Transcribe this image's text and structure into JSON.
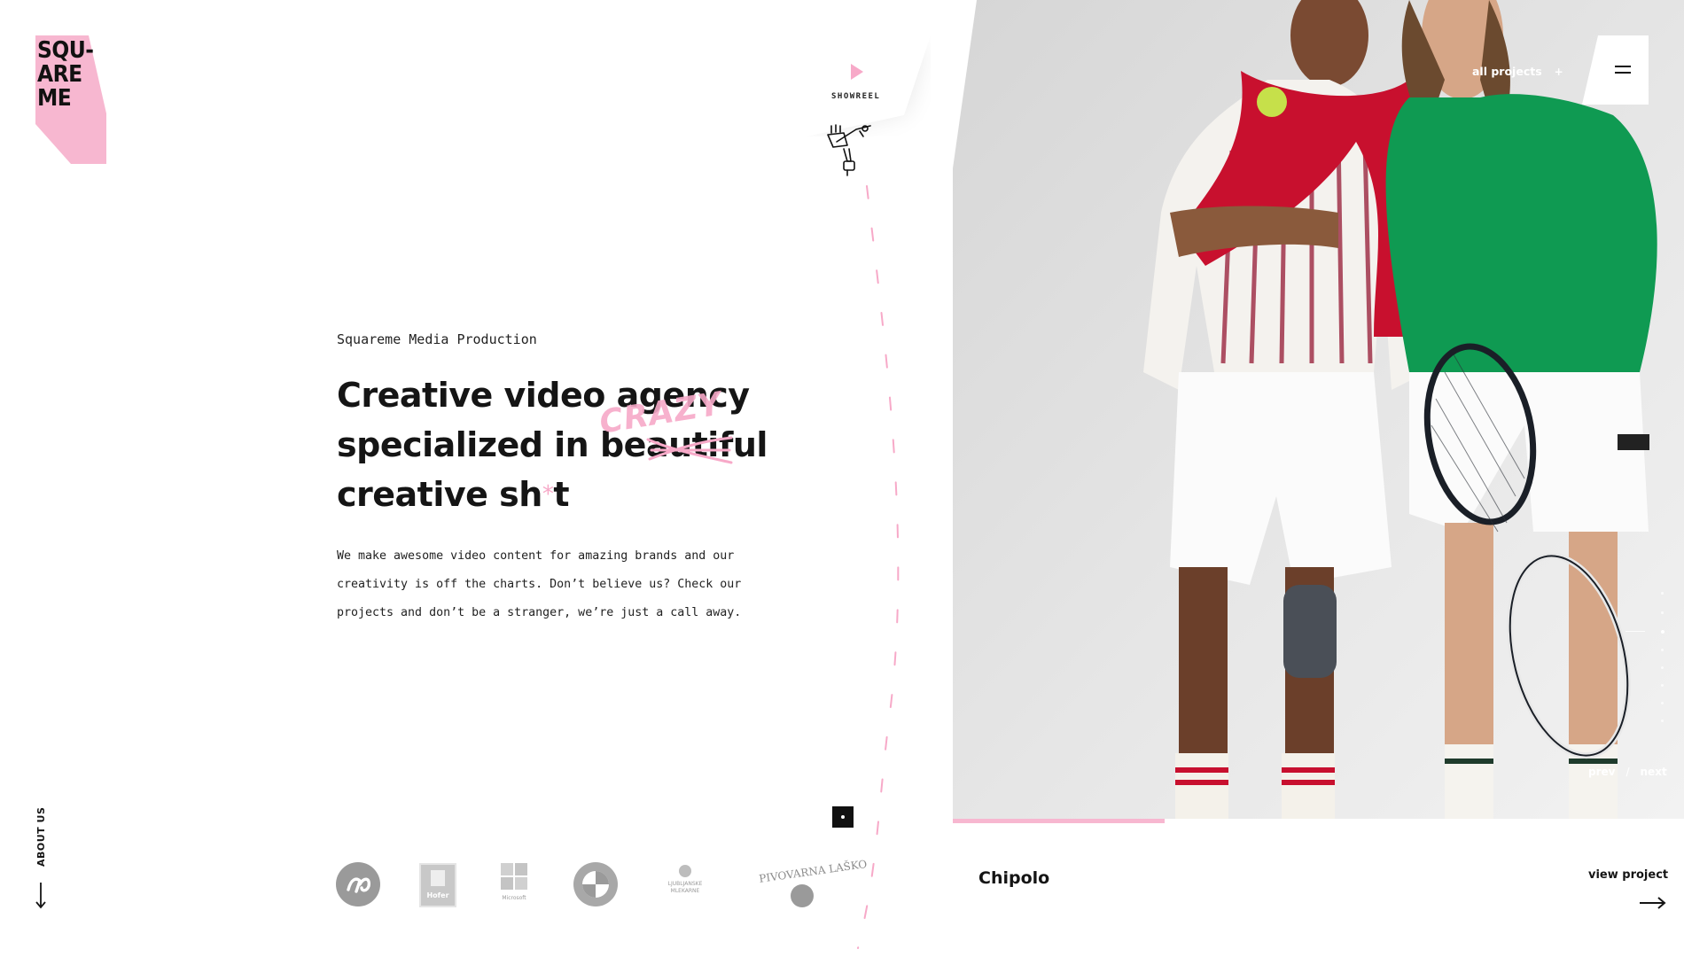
{
  "logo": {
    "lines": [
      "SQU-",
      "ARE",
      "ME"
    ],
    "color": "#f7b7d0"
  },
  "showreel": {
    "label": "SHOWREEL",
    "icon": "play-icon"
  },
  "hero": {
    "subtitle": "Squareme Media Production",
    "headline_line1": "Creative video agency",
    "headline_line2_prefix": "specialized in be",
    "headline_line2_struck": "autif",
    "headline_line2_suffix": "ul",
    "headline_overlay": "CRAZY",
    "headline_line3_prefix": "creative sh",
    "headline_line3_star": "*",
    "headline_line3_suffix": "t",
    "body": "We make awesome video content for amazing brands and our creativity is off the charts. Don’t believe us? Check our projects and don’t be a stranger, we’re just a call away."
  },
  "nav": {
    "all_projects": "all projects",
    "all_projects_icon": "+",
    "menu_icon": "hamburger-icon"
  },
  "slider": {
    "prev": "prev",
    "separator": "/",
    "next": "next",
    "total_slides": 8,
    "active_slide": 3,
    "progress": 0.29
  },
  "project": {
    "name": "Chipolo",
    "view_label": "view project"
  },
  "about": {
    "label": "ABOUT US"
  },
  "clients": [
    {
      "name": "NLB",
      "text": ""
    },
    {
      "name": "Hofer",
      "text": "Hofer"
    },
    {
      "name": "Microsoft",
      "text": "Microsoft"
    },
    {
      "name": "BMW",
      "text": ""
    },
    {
      "name": "Ljubljanske Mlekarne",
      "text": "LJUBLJANSKE MLEKARNE"
    },
    {
      "name": "Pivovarna Laško",
      "text": "PIVOVARNA LAŠKO"
    }
  ],
  "colors": {
    "accent_pink": "#f7a9c8",
    "text": "#151515",
    "background": "#ffffff"
  }
}
